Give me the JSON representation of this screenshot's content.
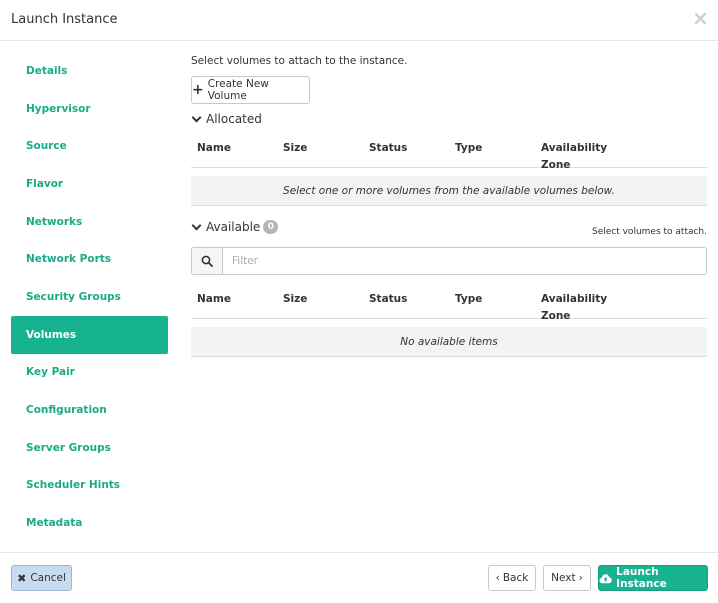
{
  "header": {
    "title": "Launch Instance"
  },
  "sidebar": {
    "items": [
      {
        "label": "Details"
      },
      {
        "label": "Hypervisor"
      },
      {
        "label": "Source"
      },
      {
        "label": "Flavor"
      },
      {
        "label": "Networks"
      },
      {
        "label": "Network Ports"
      },
      {
        "label": "Security Groups"
      },
      {
        "label": "Volumes",
        "active": true
      },
      {
        "label": "Key Pair"
      },
      {
        "label": "Configuration"
      },
      {
        "label": "Server Groups"
      },
      {
        "label": "Scheduler Hints"
      },
      {
        "label": "Metadata"
      }
    ]
  },
  "main": {
    "intro": "Select volumes to attach to the instance.",
    "create_button": "Create New Volume",
    "allocated": {
      "title": "Allocated",
      "columns": [
        "Name",
        "Size",
        "Status",
        "Type",
        "Availability Zone"
      ],
      "empty_text": "Select one or more volumes from the available volumes below."
    },
    "available": {
      "title": "Available",
      "count": "0",
      "hint": "Select volumes to attach.",
      "filter_placeholder": "Filter",
      "columns": [
        "Name",
        "Size",
        "Status",
        "Type",
        "Availability Zone"
      ],
      "empty_text": "No available items"
    }
  },
  "footer": {
    "cancel": "Cancel",
    "back": "Back",
    "next": "Next",
    "launch": "Launch Instance"
  },
  "colors": {
    "accent": "#17b390",
    "cancel_bg": "#c7dcf0"
  }
}
